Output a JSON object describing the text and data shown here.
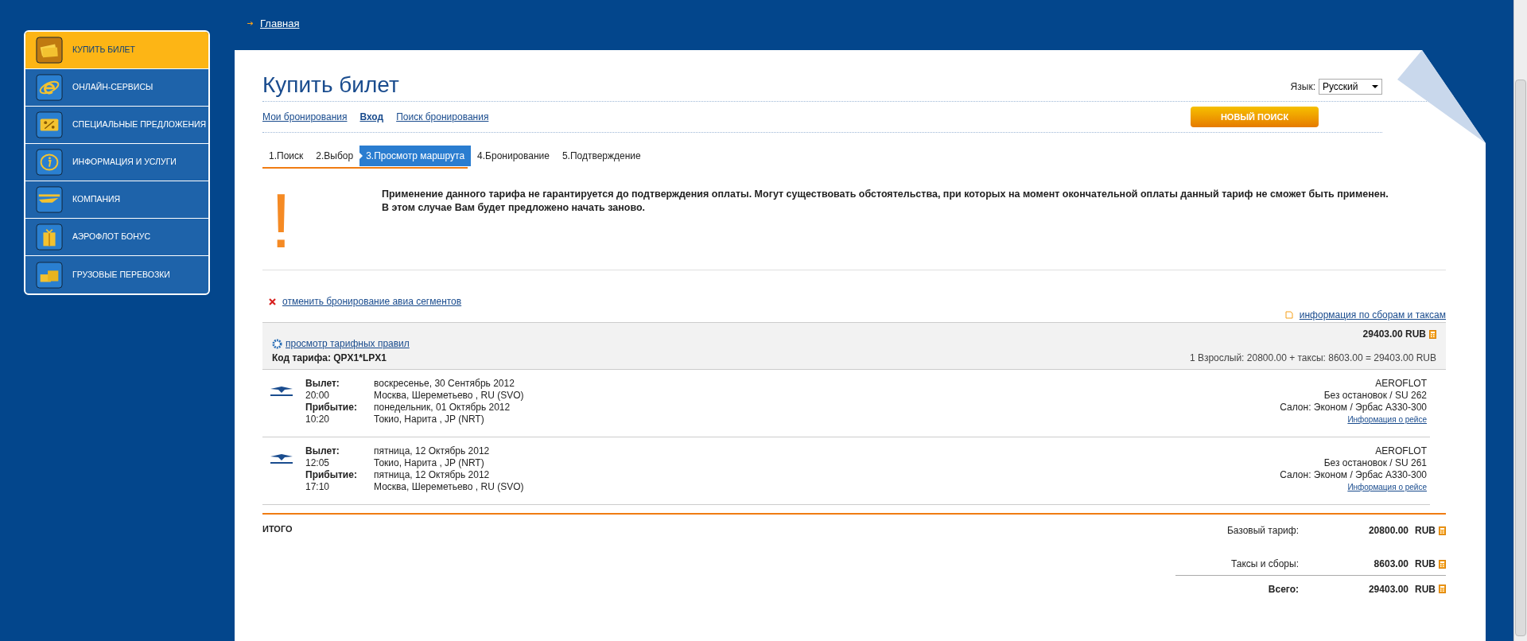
{
  "breadcrumb": {
    "label": "Главная"
  },
  "sidebar": {
    "items": [
      {
        "label": "КУПИТЬ БИЛЕТ",
        "selected": true
      },
      {
        "label": "ОНЛАЙН-СЕРВИСЫ",
        "selected": false
      },
      {
        "label": "СПЕЦИАЛЬНЫЕ ПРЕДЛОЖЕНИЯ",
        "selected": false
      },
      {
        "label": "ИНФОРМАЦИЯ И УСЛУГИ",
        "selected": false
      },
      {
        "label": "КОМПАНИЯ",
        "selected": false
      },
      {
        "label": "АЭРОФЛОТ БОНУС",
        "selected": false
      },
      {
        "label": "ГРУЗОВЫЕ ПЕРЕВОЗКИ",
        "selected": false
      }
    ]
  },
  "page": {
    "title": "Купить билет",
    "language": {
      "label": "Язык:",
      "value": "Русский"
    },
    "links": [
      {
        "label": "Мои бронирования",
        "bold": false
      },
      {
        "label": "Вход",
        "bold": true
      },
      {
        "label": "Поиск бронирования",
        "bold": false
      }
    ],
    "new_search_button": "НОВЫЙ ПОИСК"
  },
  "steps": [
    {
      "label": "1.Поиск",
      "selected": false
    },
    {
      "label": "2.Выбор",
      "selected": false
    },
    {
      "label": "3.Просмотр маршрута",
      "selected": true
    },
    {
      "label": "4.Бронирование",
      "selected": false
    },
    {
      "label": "5.Подтверждение",
      "selected": false
    }
  ],
  "warning": {
    "mark": "!",
    "text": "Применение данного тарифа не гарантируется до подтверждения оплаты. Могут существовать обстоятельства, при которых на момент окончательной оплаты данный тариф не сможет быть применен. В этом случае Вам будет предложено начать заново."
  },
  "cancel_link": "отменить бронирование авиа сегментов",
  "fees_link": "информация по сборам и таксам",
  "fare": {
    "rules_link": "просмотр тарифных правил",
    "code": "Код тарифа: QPX1*LPX1",
    "total": "29403.00 RUB",
    "breakdown": "1 Взрослый: 20800.00 + таксы: 8603.00 = 29403.00 RUB"
  },
  "flights": [
    {
      "departure_label": "Вылет:",
      "departure_time": "20:00",
      "departure_date": "воскресенье, 30 Сентябрь 2012",
      "departure_place": "Москва, Шереметьево , RU (SVO)",
      "arrival_label": "Прибытие:",
      "arrival_time": "10:20",
      "arrival_date": "понедельник, 01 Октябрь 2012",
      "arrival_place": "Токио, Нарита , JP (NRT)",
      "airline": "AEROFLOT",
      "stops": "Без остановок / SU 262",
      "cabin": "Салон: Эконом / Эрбас A330-300",
      "info_link": "Информация о рейсе"
    },
    {
      "departure_label": "Вылет:",
      "departure_time": "12:05",
      "departure_date": "пятница, 12 Октябрь 2012",
      "departure_place": "Токио, Нарита , JP (NRT)",
      "arrival_label": "Прибытие:",
      "arrival_time": "17:10",
      "arrival_date": "пятница, 12 Октябрь 2012",
      "arrival_place": "Москва, Шереметьево , RU (SVO)",
      "airline": "AEROFLOT",
      "stops": "Без остановок / SU 261",
      "cabin": "Салон: Эконом / Эрбас A330-300",
      "info_link": "Информация о рейсе"
    }
  ],
  "totals": {
    "title": "ИТОГО",
    "rows": [
      {
        "kind": "line",
        "label": "Базовый тариф:",
        "amount": "20800.00",
        "currency": "RUB"
      },
      {
        "kind": "line",
        "label": "Таксы и сборы:",
        "amount": "8603.00",
        "currency": "RUB"
      },
      {
        "kind": "total",
        "label": "Всего:",
        "amount": "29403.00",
        "currency": "RUB"
      }
    ]
  }
}
